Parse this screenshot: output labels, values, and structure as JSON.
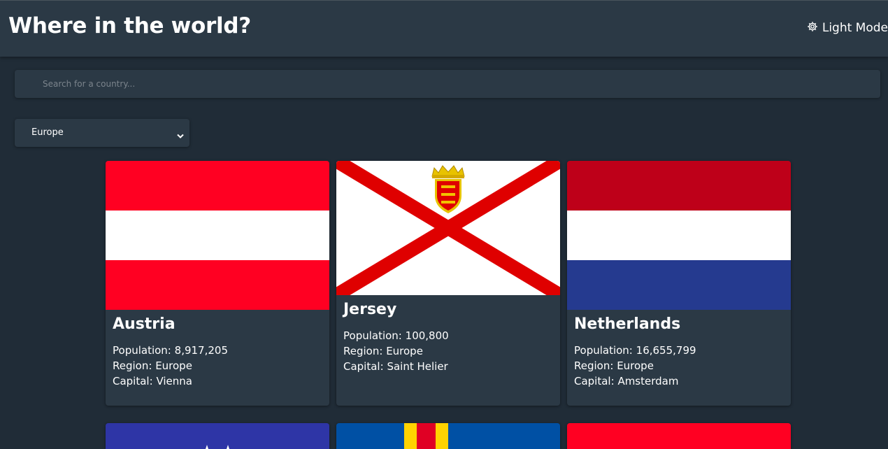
{
  "header": {
    "title": "Where in the world?",
    "mode_label": "Light Mode",
    "mode_icon": "gear-icon"
  },
  "search": {
    "placeholder": "Search for a country...",
    "value": ""
  },
  "filter": {
    "selected": "Europe"
  },
  "labels": {
    "population": "Population:",
    "region": "Region:",
    "capital": "Capital:"
  },
  "countries": [
    {
      "name": "Austria",
      "population": "8,917,205",
      "region": "Europe",
      "capital": "Vienna",
      "flag": "austria-flag",
      "colors": [
        "#ff0022",
        "#ffffff",
        "#ff0022"
      ]
    },
    {
      "name": "Jersey",
      "population": "100,800",
      "region": "Europe",
      "capital": "Saint Helier",
      "flag": "jersey-flag",
      "colors": [
        "#ffffff",
        "#df0000"
      ]
    },
    {
      "name": "Netherlands",
      "population": "16,655,799",
      "region": "Europe",
      "capital": "Amsterdam",
      "flag": "netherlands-flag",
      "colors": [
        "#be0019",
        "#ffffff",
        "#253a8f"
      ]
    },
    {
      "name": "",
      "flag": "blue-flag-with-stars",
      "colors": [
        "#2e35a6",
        "#ffffff"
      ]
    },
    {
      "name": "",
      "flag": "aland-flag",
      "colors": [
        "#0050a4",
        "#ffd300",
        "#e00024"
      ]
    },
    {
      "name": "",
      "flag": "red-flag",
      "colors": [
        "#ff0022"
      ]
    }
  ],
  "theme": {
    "background": "#202c37",
    "element": "#2b3945",
    "text": "#ffffff"
  }
}
